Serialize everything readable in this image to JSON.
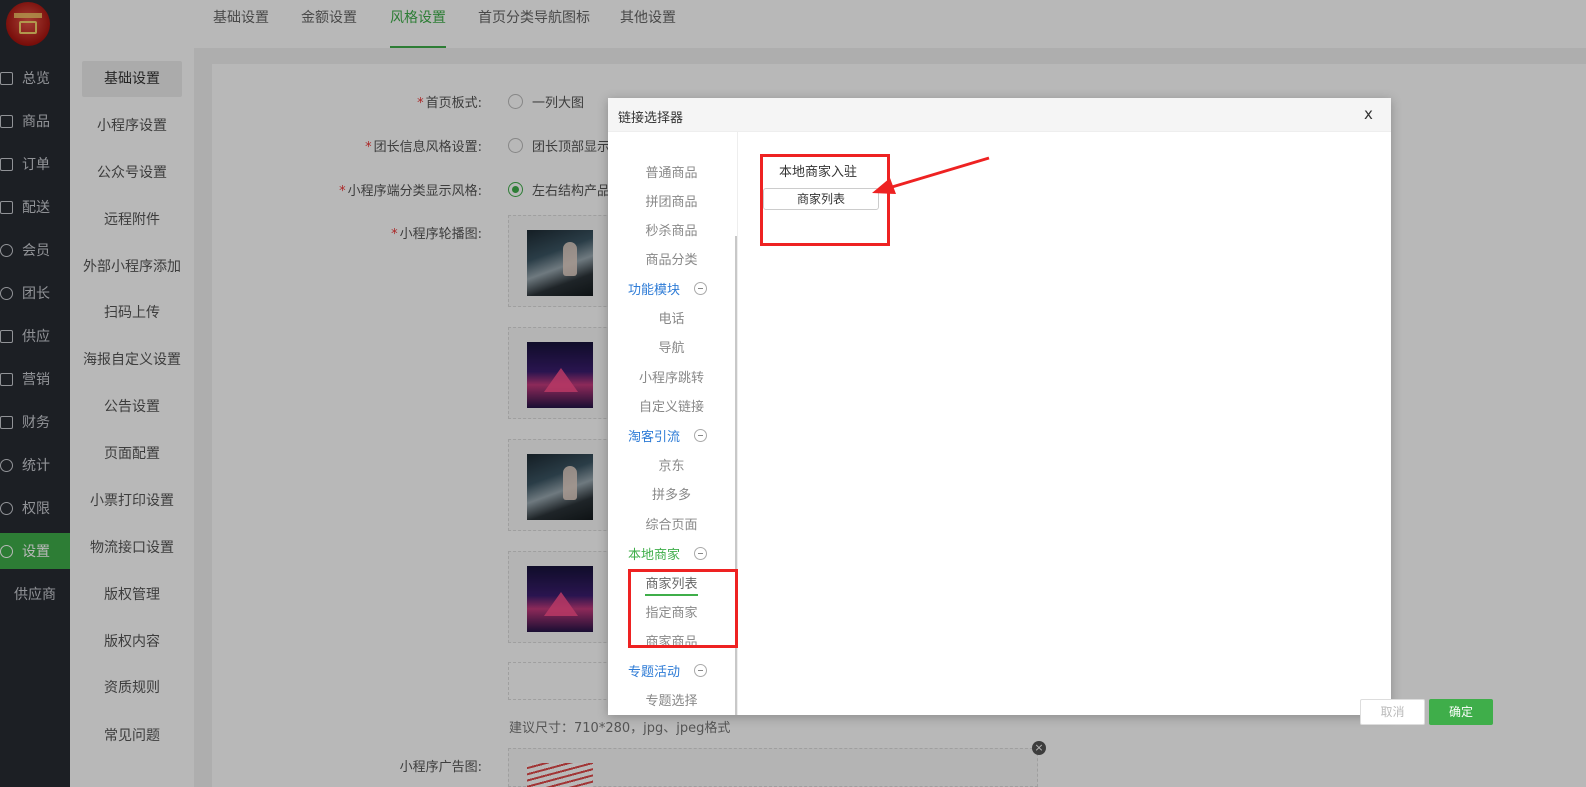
{
  "sidebar": {
    "items": [
      {
        "label": "总览",
        "icon": "home-icon"
      },
      {
        "label": "商品",
        "icon": "bag-icon"
      },
      {
        "label": "订单",
        "icon": "order-icon"
      },
      {
        "label": "配送",
        "icon": "truck-icon"
      },
      {
        "label": "会员",
        "icon": "user-icon"
      },
      {
        "label": "团长",
        "icon": "leader-icon"
      },
      {
        "label": "供应",
        "icon": "supply-icon"
      },
      {
        "label": "营销",
        "icon": "gift-icon"
      },
      {
        "label": "财务",
        "icon": "yen-icon"
      },
      {
        "label": "统计",
        "icon": "pie-chart-icon"
      },
      {
        "label": "权限",
        "icon": "shield-icon"
      },
      {
        "label": "设置",
        "icon": "gear-icon",
        "active": true
      },
      {
        "label": "供应商",
        "icon": ""
      }
    ]
  },
  "submenu": {
    "items": [
      "基础设置",
      "小程序设置",
      "公众号设置",
      "远程附件",
      "外部小程序添加",
      "扫码上传",
      "海报自定义设置",
      "公告设置",
      "页面配置",
      "小票打印设置",
      "物流接口设置",
      "版权管理",
      "版权内容",
      "资质规则",
      "常见问题"
    ]
  },
  "tabs": [
    "基础设置",
    "金额设置",
    "风格设置",
    "首页分类导航图标",
    "其他设置"
  ],
  "form": {
    "homepage_style_label": "首页板式:",
    "homepage_option1": "一列大图",
    "leader_style_label": "团长信息风格设置:",
    "leader_option1": "团长顶部显示",
    "category_style_label": "小程序端分类显示风格:",
    "category_option1": "左右结构产品",
    "carousel_label": "小程序轮播图:",
    "size_hint": "建议尺寸：710*280，jpg、jpeg格式",
    "ad_label": "小程序广告图:"
  },
  "modal": {
    "title": "链接选择器",
    "close": "x",
    "tree": {
      "leaves_top": [
        "普通商品",
        "拼团商品",
        "秒杀商品",
        "商品分类"
      ],
      "group_function": "功能模块",
      "leaves_function": [
        "电话",
        "导航",
        "小程序跳转",
        "自定义链接"
      ],
      "group_taoke": "淘客引流",
      "leaves_taoke": [
        "京东",
        "拼多多",
        "综合页面"
      ],
      "group_local": "本地商家",
      "leaves_local": [
        "商家列表",
        "指定商家",
        "商家商品"
      ],
      "group_topic": "专题活动",
      "leaves_topic": [
        "专题选择"
      ]
    },
    "right_title": "本地商家入驻",
    "right_button": "商家列表",
    "cancel": "取消",
    "confirm": "确定"
  },
  "colors": {
    "accent": "#3fae4a",
    "link": "#2d7bd6",
    "annotation": "#ee2222",
    "sidebar_bg": "#282b33"
  }
}
